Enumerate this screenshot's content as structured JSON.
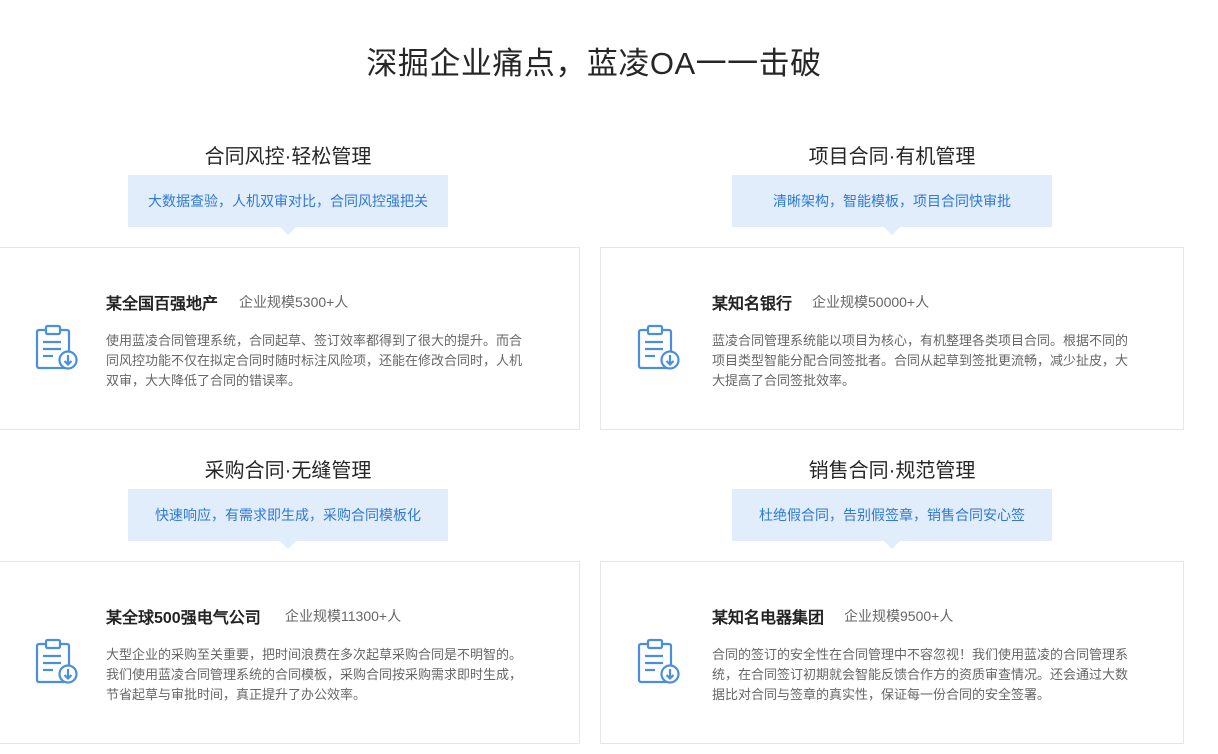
{
  "page": {
    "title": "深掘企业痛点，蓝凌OA一一击破"
  },
  "sections": [
    {
      "title": "合同风控·轻松管理",
      "tag": "大数据查验，人机双审对比，合同风控强把关",
      "company": "某全国百强地产",
      "scale": "企业规模5300+人",
      "description": "使用蓝凌合同管理系统，合同起草、签订效率都得到了很大的提升。而合同风控功能不仅在拟定合同时随时标注风险项，还能在修改合同时，人机双审，大大降低了合同的错误率。",
      "icon": "contract-download-icon"
    },
    {
      "title": "项目合同·有机管理",
      "tag": "清晰架构，智能模板，项目合同快审批",
      "company": "某知名银行",
      "scale": "企业规模50000+人",
      "description": "蓝凌合同管理系统能以项目为核心，有机整理各类项目合同。根据不同的项目类型智能分配合同签批者。合同从起草到签批更流畅，减少扯皮，大大提高了合同签批效率。",
      "icon": "contract-download-icon"
    },
    {
      "title": "采购合同·无缝管理",
      "tag": "快速响应，有需求即生成，采购合同模板化",
      "company": "某全球500强电气公司",
      "scale": "企业规模11300+人",
      "description": "大型企业的采购至关重要，把时间浪费在多次起草采购合同是不明智的。我们使用蓝凌合同管理系统的合同模板，采购合同按采购需求即时生成，节省起草与审批时间，真正提升了办公效率。",
      "icon": "contract-download-icon"
    },
    {
      "title": "销售合同·规范管理",
      "tag": "杜绝假合同，告别假签章，销售合同安心签",
      "company": "某知名电器集团",
      "scale": "企业规模9500+人",
      "description": "合同的签订的安全性在合同管理中不容忽视！我们使用蓝凌的合同管理系统，在合同签订初期就会智能反馈合作方的资质审查情况。还会通过大数据比对合同与签章的真实性，保证每一份合同的安全签署。",
      "icon": "contract-download-icon"
    }
  ],
  "colors": {
    "accent": "#2f79d8",
    "tag_background": "#e1edfb",
    "icon_stroke": "#4a8ee2",
    "card_border": "#e6e6e6"
  }
}
